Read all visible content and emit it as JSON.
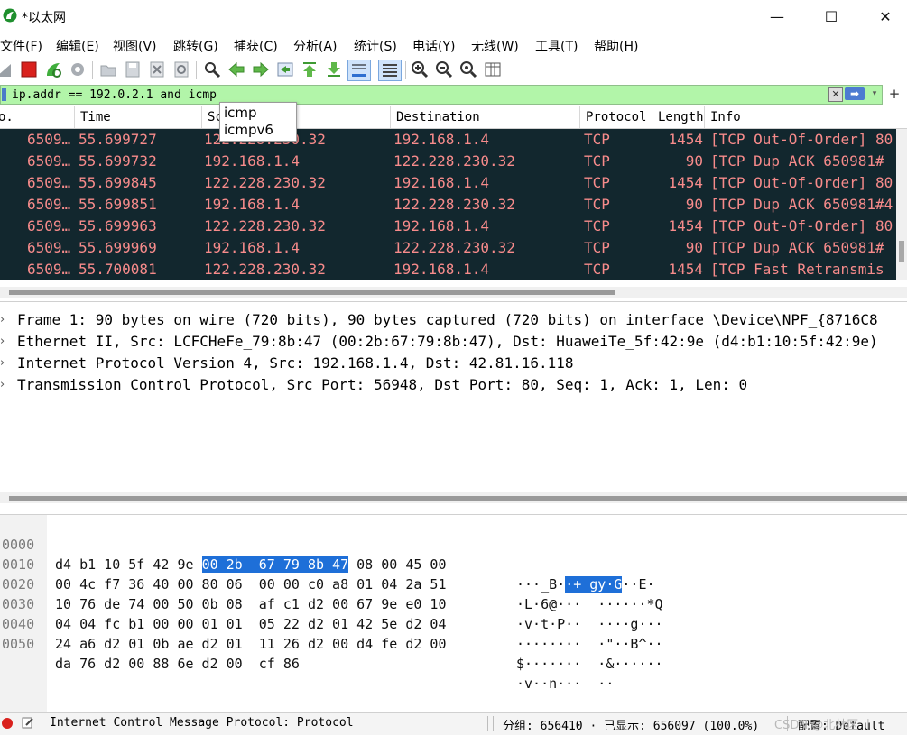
{
  "window": {
    "title": "*以太网",
    "controls": {
      "minimize": "—",
      "maximize": "☐",
      "close": "✕"
    }
  },
  "menu": [
    "文件(F)",
    "编辑(E)",
    "视图(V)",
    "跳转(G)",
    "捕获(C)",
    "分析(A)",
    "统计(S)",
    "电话(Y)",
    "无线(W)",
    "工具(T)",
    "帮助(H)"
  ],
  "filter": {
    "value": "ip.addr == 192.0.2.1 and icmp",
    "clear_icon": "clear-filter-icon",
    "apply_icon": "apply-filter-arrow-icon",
    "add": "+"
  },
  "autocomplete": [
    "icmp",
    "icmpv6"
  ],
  "packet_list": {
    "columns": [
      "No.",
      "Time",
      "Source",
      "Destination",
      "Protocol",
      "Length",
      "Info"
    ],
    "header_visible": [
      "o.",
      "Time",
      "Sc",
      "Destination",
      "Protocol",
      "Length",
      "Info"
    ],
    "rows": [
      {
        "no": "6509…",
        "time": "55.699727",
        "src": "122.228.230.32",
        "dst": "192.168.1.4",
        "proto": "TCP",
        "len": "1454",
        "info": "[TCP Out-Of-Order] 80"
      },
      {
        "no": "6509…",
        "time": "55.699732",
        "src": "192.168.1.4",
        "dst": "122.228.230.32",
        "proto": "TCP",
        "len": "90",
        "info": "[TCP Dup ACK 650981#"
      },
      {
        "no": "6509…",
        "time": "55.699845",
        "src": "122.228.230.32",
        "dst": "192.168.1.4",
        "proto": "TCP",
        "len": "1454",
        "info": "[TCP Out-Of-Order] 80"
      },
      {
        "no": "6509…",
        "time": "55.699851",
        "src": "192.168.1.4",
        "dst": "122.228.230.32",
        "proto": "TCP",
        "len": "90",
        "info": "[TCP Dup ACK 650981#4"
      },
      {
        "no": "6509…",
        "time": "55.699963",
        "src": "122.228.230.32",
        "dst": "192.168.1.4",
        "proto": "TCP",
        "len": "1454",
        "info": "[TCP Out-Of-Order] 80"
      },
      {
        "no": "6509…",
        "time": "55.699969",
        "src": "192.168.1.4",
        "dst": "122.228.230.32",
        "proto": "TCP",
        "len": "90",
        "info": "[TCP Dup ACK 650981#"
      },
      {
        "no": "6509…",
        "time": "55.700081",
        "src": "122.228.230.32",
        "dst": "192.168.1.4",
        "proto": "TCP",
        "len": "1454",
        "info": "[TCP Fast Retransmis"
      }
    ]
  },
  "details": [
    "Frame 1: 90 bytes on wire (720 bits), 90 bytes captured (720 bits) on interface \\Device\\NPF_{8716C8",
    "Ethernet II, Src: LCFCHeFe_79:8b:47 (00:2b:67:79:8b:47), Dst: HuaweiTe_5f:42:9e (d4:b1:10:5f:42:9e)",
    "Internet Protocol Version 4, Src: 192.168.1.4, Dst: 42.81.16.118",
    "Transmission Control Protocol, Src Port: 56948, Dst Port: 80, Seq: 1, Ack: 1, Len: 0"
  ],
  "bytes": [
    {
      "offset": "0000",
      "hex_a": "d4 b1 10 5f 42 9e ",
      "hex_hl": "00 2b  67 79 8b 47",
      "hex_b": " 08 00 45 00",
      "ascii_a": "···_B·",
      "ascii_hl": "·+ gy·G",
      "ascii_b": "··E·"
    },
    {
      "offset": "0010",
      "hex_a": "00 4c f7 36 40 00 80 06  00 00 c0 a8 01 04 2a 51",
      "hex_hl": "",
      "hex_b": "",
      "ascii_a": "·L·6@···  ······*Q",
      "ascii_hl": "",
      "ascii_b": ""
    },
    {
      "offset": "0020",
      "hex_a": "10 76 de 74 00 50 0b 08  af c1 d2 00 67 9e e0 10",
      "hex_hl": "",
      "hex_b": "",
      "ascii_a": "·v·t·P··  ····g···",
      "ascii_hl": "",
      "ascii_b": ""
    },
    {
      "offset": "0030",
      "hex_a": "04 04 fc b1 00 00 01 01  05 22 d2 01 42 5e d2 04",
      "hex_hl": "",
      "hex_b": "",
      "ascii_a": "········  ·\"··B^··",
      "ascii_hl": "",
      "ascii_b": ""
    },
    {
      "offset": "0040",
      "hex_a": "24 a6 d2 01 0b ae d2 01  11 26 d2 00 d4 fe d2 00",
      "hex_hl": "",
      "hex_b": "",
      "ascii_a": "$·······  ·&······",
      "ascii_hl": "",
      "ascii_b": ""
    },
    {
      "offset": "0050",
      "hex_a": "da 76 d2 00 88 6e d2 00  cf 86",
      "hex_hl": "",
      "hex_b": "",
      "ascii_a": "·v··n···  ··",
      "ascii_hl": "",
      "ascii_b": ""
    }
  ],
  "status": {
    "message": "Internet Control Message Protocol: Protocol",
    "packets": "分组: 656410 · 已显示: 656097 (100.0%)",
    "profile": "配置: Default",
    "watermark": "CSDN @北林区 丨"
  },
  "colors": {
    "packet_row_bg": "#12272e",
    "packet_row_fg": "#f78b8b",
    "filter_valid_bg": "#b2f5a9",
    "byte_highlight": "#1e6fd8",
    "capture_stop": "#d9211d"
  }
}
